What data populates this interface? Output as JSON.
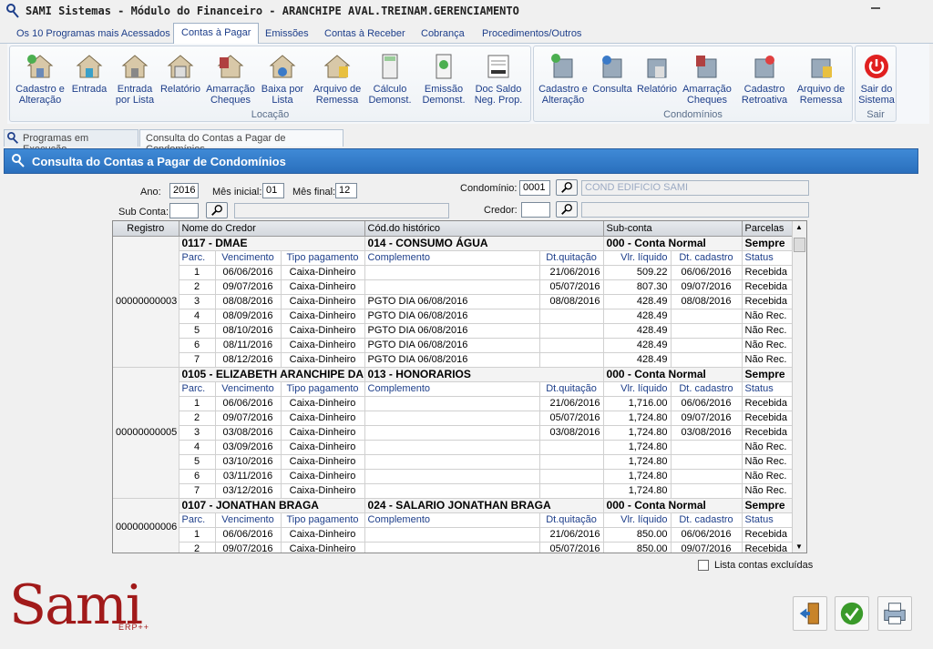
{
  "window": {
    "title": "SAMI Sistemas - Módulo do Financeiro - ARANCHIPE AVAL.TREINAM.GERENCIAMENTO"
  },
  "tabs": [
    "Os 10 Programas mais Acessados",
    "Contas à Pagar",
    "Emissões",
    "Contas à Receber",
    "Cobrança",
    "Procedimentos/Outros"
  ],
  "ribbon": {
    "locacao": {
      "label": "Locação",
      "buttons": [
        "Cadastro e Alteração",
        "Entrada",
        "Entrada por Lista",
        "Relatório",
        "Amarração Cheques",
        "Baixa por Lista",
        "Arquivo de Remessa",
        "Cálculo Demonst.",
        "Emissão Demonst.",
        "Doc Saldo Neg. Prop."
      ]
    },
    "condominios": {
      "label": "Condomínios",
      "buttons": [
        "Cadastro e Alteração",
        "Consulta",
        "Relatório",
        "Amarração Cheques",
        "Cadastro Retroativa",
        "Arquivo de Remessa"
      ]
    },
    "sair": {
      "label": "Sair",
      "buttons": [
        "Sair do Sistema"
      ]
    }
  },
  "subtabs": [
    "Programas em Execução",
    "Consulta do Contas a Pagar de Condomínios"
  ],
  "header": "Consulta do Contas a Pagar de Condomínios",
  "form": {
    "ano_label": "Ano:",
    "ano": "2016",
    "mes_inicial_label": "Mês inicial:",
    "mes_inicial": "01",
    "mes_final_label": "Mês final:",
    "mes_final": "12",
    "condominio_label": "Condomínio:",
    "condominio": "0001",
    "condominio_nome": "COND EDIFICIO SAMI",
    "sub_conta_label": "Sub Conta:",
    "sub_conta": "",
    "credor_label": "Credor:",
    "credor": ""
  },
  "grid": {
    "headers": [
      "Registro",
      "Nome do Credor",
      "Cód.do histórico",
      "Sub-conta",
      "Parcelas"
    ],
    "sub_headers": [
      "Parc.",
      "Vencimento",
      "Tipo pagamento",
      "Complemento",
      "Dt.quitação",
      "Vlr. líquido",
      "Dt. cadastro",
      "Status"
    ],
    "groups": [
      {
        "registro": "00000000003",
        "credor": "0117 - DMAE",
        "historico": "014 - CONSUMO ÁGUA",
        "subconta": "000 - Conta Normal",
        "parcelas": "Sempre",
        "rows": [
          [
            "1",
            "06/06/2016",
            "Caixa-Dinheiro",
            "",
            "21/06/2016",
            "509.22",
            "06/06/2016",
            "Recebida"
          ],
          [
            "2",
            "09/07/2016",
            "Caixa-Dinheiro",
            "",
            "05/07/2016",
            "807.30",
            "09/07/2016",
            "Recebida"
          ],
          [
            "3",
            "08/08/2016",
            "Caixa-Dinheiro",
            "PGTO DIA 06/08/2016",
            "08/08/2016",
            "428.49",
            "08/08/2016",
            "Recebida"
          ],
          [
            "4",
            "08/09/2016",
            "Caixa-Dinheiro",
            "PGTO DIA 06/08/2016",
            "",
            "428.49",
            "",
            "Não Rec."
          ],
          [
            "5",
            "08/10/2016",
            "Caixa-Dinheiro",
            "PGTO DIA 06/08/2016",
            "",
            "428.49",
            "",
            "Não Rec."
          ],
          [
            "6",
            "08/11/2016",
            "Caixa-Dinheiro",
            "PGTO DIA 06/08/2016",
            "",
            "428.49",
            "",
            "Não Rec."
          ],
          [
            "7",
            "08/12/2016",
            "Caixa-Dinheiro",
            "PGTO DIA 06/08/2016",
            "",
            "428.49",
            "",
            "Não Rec."
          ]
        ]
      },
      {
        "registro": "00000000005",
        "credor": "0105 - ELIZABETH ARANCHIPE DA",
        "historico": "013 - HONORARIOS",
        "subconta": "000 - Conta Normal",
        "parcelas": "Sempre",
        "rows": [
          [
            "1",
            "06/06/2016",
            "Caixa-Dinheiro",
            "",
            "21/06/2016",
            "1,716.00",
            "06/06/2016",
            "Recebida"
          ],
          [
            "2",
            "09/07/2016",
            "Caixa-Dinheiro",
            "",
            "05/07/2016",
            "1,724.80",
            "09/07/2016",
            "Recebida"
          ],
          [
            "3",
            "03/08/2016",
            "Caixa-Dinheiro",
            "",
            "03/08/2016",
            "1,724.80",
            "03/08/2016",
            "Recebida"
          ],
          [
            "4",
            "03/09/2016",
            "Caixa-Dinheiro",
            "",
            "",
            "1,724.80",
            "",
            "Não Rec."
          ],
          [
            "5",
            "03/10/2016",
            "Caixa-Dinheiro",
            "",
            "",
            "1,724.80",
            "",
            "Não Rec."
          ],
          [
            "6",
            "03/11/2016",
            "Caixa-Dinheiro",
            "",
            "",
            "1,724.80",
            "",
            "Não Rec."
          ],
          [
            "7",
            "03/12/2016",
            "Caixa-Dinheiro",
            "",
            "",
            "1,724.80",
            "",
            "Não Rec."
          ]
        ]
      },
      {
        "registro": "00000000006",
        "credor": "0107 - JONATHAN BRAGA",
        "historico": "024 - SALARIO JONATHAN BRAGA",
        "subconta": "000 - Conta Normal",
        "parcelas": "Sempre",
        "rows": [
          [
            "1",
            "06/06/2016",
            "Caixa-Dinheiro",
            "",
            "21/06/2016",
            "850.00",
            "06/06/2016",
            "Recebida"
          ],
          [
            "2",
            "09/07/2016",
            "Caixa-Dinheiro",
            "",
            "05/07/2016",
            "850.00",
            "09/07/2016",
            "Recebida"
          ]
        ]
      }
    ]
  },
  "lista_excluidas": "Lista contas excluídas",
  "logo": {
    "text": "Sami",
    "sub": "ERP++"
  }
}
